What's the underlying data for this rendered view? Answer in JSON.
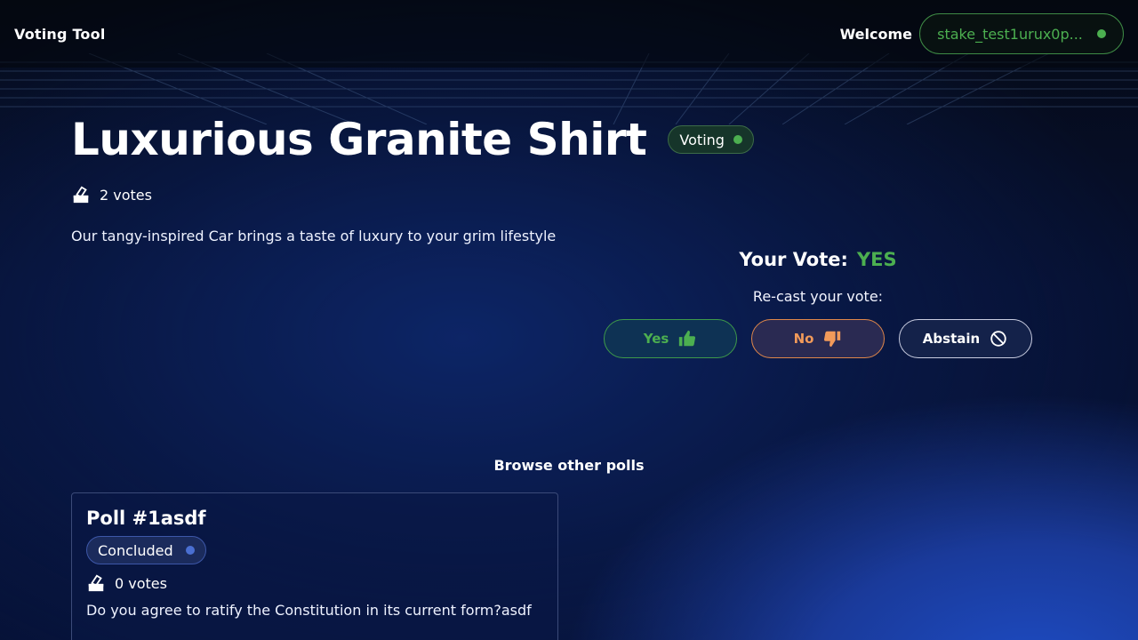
{
  "header": {
    "brand": "Voting Tool",
    "welcome": "Welcome",
    "wallet": "stake_test1urux0p..."
  },
  "poll": {
    "title": "Luxurious Granite Shirt",
    "status": "Voting",
    "votes": "2 votes",
    "description": "Our tangy-inspired Car brings a taste of luxury to your grim lifestyle"
  },
  "vote_panel": {
    "your_vote_label": "Your Vote:",
    "your_vote_value": "YES",
    "recast_label": "Re-cast your vote:",
    "yes_label": "Yes",
    "no_label": "No",
    "abstain_label": "Abstain"
  },
  "browse": {
    "heading": "Browse other polls",
    "cards": [
      {
        "title": "Poll #1asdf",
        "status": "Concluded",
        "votes": "0 votes",
        "description": "Do you agree to ratify the Constitution in its current form?asdf"
      }
    ]
  },
  "colors": {
    "accent_green": "#4caf50",
    "accent_orange": "#f29a5a",
    "concluded_blue": "#4a6fd1"
  },
  "icons": {
    "ballot": "ballot-box-icon",
    "thumbs_up": "thumbs-up-icon",
    "thumbs_down": "thumbs-down-icon",
    "abstain": "prohibited-icon"
  }
}
